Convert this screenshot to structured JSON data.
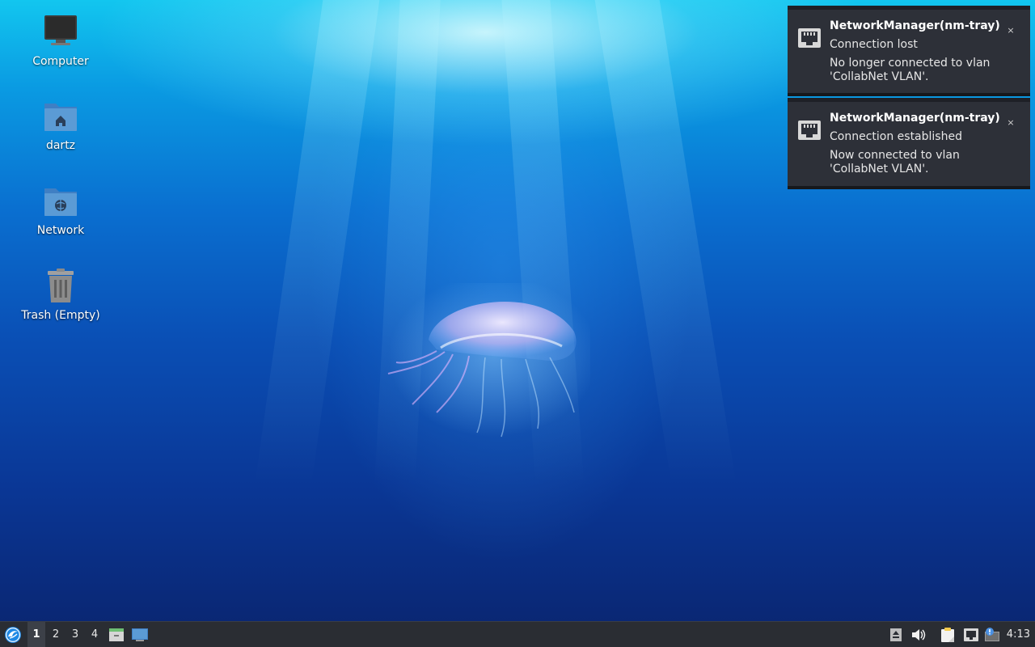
{
  "desktop": {
    "icons": [
      {
        "label": "Computer",
        "icon": "computer-icon"
      },
      {
        "label": "dartz",
        "icon": "home-folder-icon"
      },
      {
        "label": "Network",
        "icon": "network-folder-icon"
      },
      {
        "label": "Trash (Empty)",
        "icon": "trash-icon"
      }
    ]
  },
  "notifications": [
    {
      "app": "NetworkManager(nm-tray)",
      "summary": "Connection lost",
      "body": "No longer connected to vlan 'CollabNet VLAN'.",
      "close": "×",
      "icon": "ethernet-icon"
    },
    {
      "app": "NetworkManager(nm-tray)",
      "summary": "Connection established",
      "body": "Now connected to vlan 'CollabNet VLAN'.",
      "close": "×",
      "icon": "ethernet-icon"
    }
  ],
  "taskbar": {
    "menu_icon": "lubuntu-menu-icon",
    "workspaces": [
      "1",
      "2",
      "3",
      "4"
    ],
    "active_workspace": "1",
    "launchers": [
      "file-manager-icon",
      "show-desktop-icon"
    ],
    "tray": [
      "eject-icon",
      "volume-icon",
      "clipboard-icon",
      "network-icon",
      "update-notifier-icon"
    ],
    "clock": "4:13"
  },
  "colors": {
    "panel": "#2a2d33",
    "notification_bg": "#2d3038",
    "folder_blue": "#5b9bd5"
  }
}
